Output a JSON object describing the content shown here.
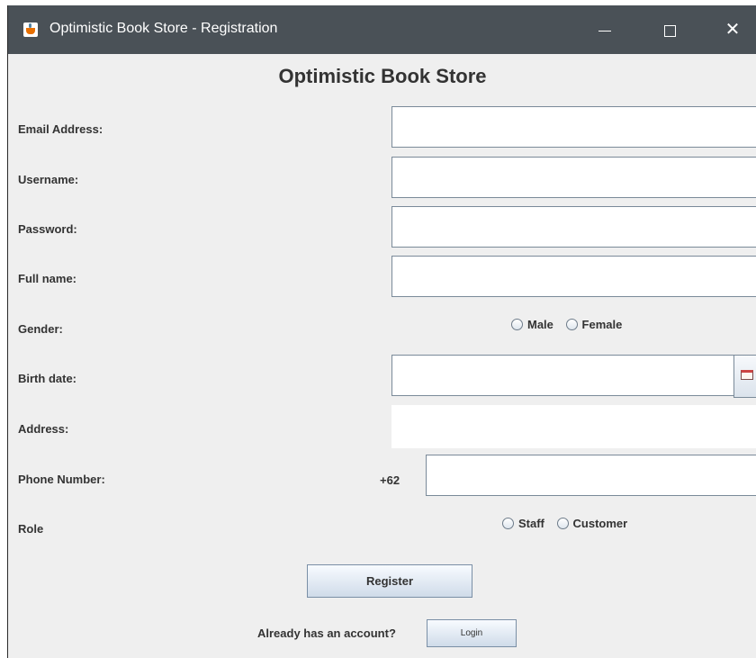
{
  "window": {
    "title": "Optimistic Book Store - Registration",
    "controls": {
      "minimize": "—",
      "maximize": "☐",
      "close": "✕"
    }
  },
  "form": {
    "heading": "Optimistic Book Store",
    "email_label": "Email Address:",
    "email_value": "",
    "username_label": "Username:",
    "username_value": "",
    "password_label": "Password:",
    "password_value": "",
    "fullname_label": "Full name:",
    "fullname_value": "",
    "gender_label": "Gender:",
    "gender_options": [
      "Male",
      "Female"
    ],
    "birthdate_label": "Birth date:",
    "birthdate_value": "",
    "address_label": "Address:",
    "address_value": "",
    "phone_label": "Phone Number:",
    "phone_prefix": "+62",
    "phone_value": "",
    "role_label": "Role",
    "role_options": [
      "Staff",
      "Customer"
    ],
    "register_button": "Register",
    "already_text": "Already has an account?",
    "login_button": "Login"
  },
  "icons": {
    "app": "java-cup-icon",
    "calendar": "calendar-icon"
  },
  "colors": {
    "titlebar": "#4a5157",
    "window_bg": "#efefef",
    "text": "#333333",
    "field_border": "#7a8a99"
  }
}
